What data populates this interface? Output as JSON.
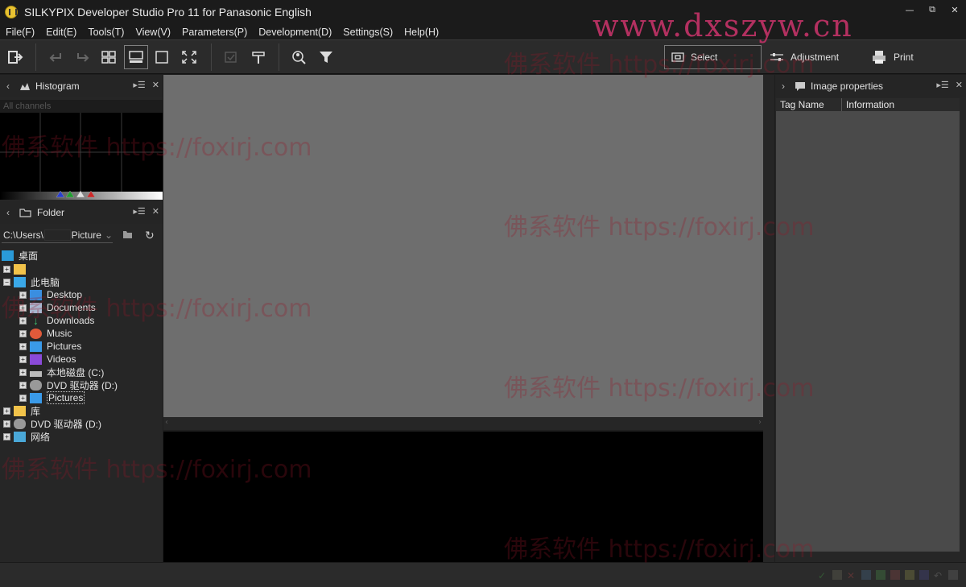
{
  "window": {
    "title": "SILKYPIX Developer Studio Pro 11 for Panasonic English",
    "controls": {
      "minimize": "—",
      "restore": "⧉",
      "close": "✕"
    }
  },
  "menu": [
    "File(F)",
    "Edit(E)",
    "Tools(T)",
    "View(V)",
    "Parameters(P)",
    "Development(D)",
    "Settings(S)",
    "Help(H)"
  ],
  "toolbar": {
    "modes": {
      "select": "Select",
      "adjustment": "Adjustment",
      "print": "Print"
    }
  },
  "histogram": {
    "title": "Histogram",
    "channel": "All channels"
  },
  "folder": {
    "title": "Folder",
    "path_start": "C:\\Users\\",
    "path_end": "Picture"
  },
  "tree": [
    {
      "label": "桌面",
      "level": 0,
      "icon": "desktop-icon",
      "expander": ""
    },
    {
      "label": "",
      "level": 0,
      "icon": "folder-icon",
      "expander": "+"
    },
    {
      "label": "此电脑",
      "level": 0,
      "icon": "computer-icon",
      "expander": "−"
    },
    {
      "label": "Desktop",
      "level": 1,
      "icon": "desktop-icon",
      "expander": "+"
    },
    {
      "label": "Documents",
      "level": 1,
      "icon": "documents-icon",
      "expander": "+"
    },
    {
      "label": "Downloads",
      "level": 1,
      "icon": "downloads-icon",
      "expander": "+"
    },
    {
      "label": "Music",
      "level": 1,
      "icon": "music-icon",
      "expander": "+"
    },
    {
      "label": "Pictures",
      "level": 1,
      "icon": "pictures-icon",
      "expander": "+"
    },
    {
      "label": "Videos",
      "level": 1,
      "icon": "videos-icon",
      "expander": "+"
    },
    {
      "label": "本地磁盘 (C:)",
      "level": 1,
      "icon": "disk-icon",
      "expander": "+"
    },
    {
      "label": "DVD 驱动器 (D:)",
      "level": 1,
      "icon": "dvd-icon",
      "expander": "+"
    },
    {
      "label": "Pictures",
      "level": 1,
      "icon": "pictures-icon",
      "expander": "+",
      "selected": true
    },
    {
      "label": "库",
      "level": 0,
      "icon": "folder-icon",
      "expander": "+"
    },
    {
      "label": "DVD 驱动器 (D:)",
      "level": 0,
      "icon": "dvd-icon",
      "expander": "+"
    },
    {
      "label": "网络",
      "level": 0,
      "icon": "network-icon",
      "expander": "+"
    }
  ],
  "image_properties": {
    "title": "Image properties",
    "columns": [
      "Tag Name",
      "Information"
    ]
  },
  "watermarks": {
    "site": "www.dxszyw.cn",
    "text": "佛系软件 https://foxirj.com"
  },
  "colors": {
    "accent_yellow": "#e8c232",
    "preview_gray": "#6e6e6e",
    "watermark": "#b33060"
  }
}
